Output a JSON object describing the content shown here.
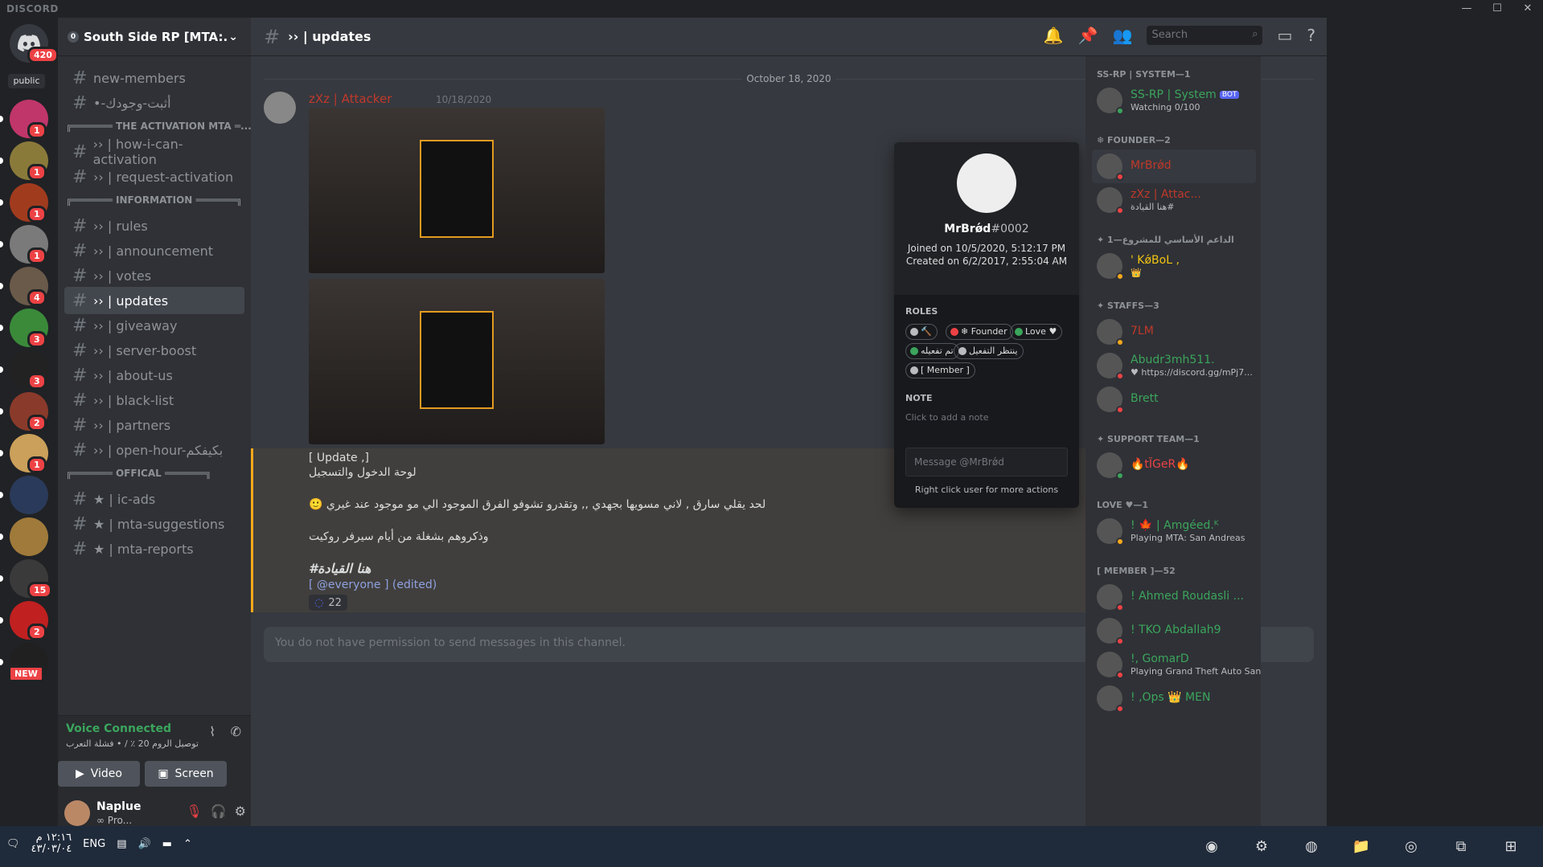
{
  "window": {
    "brand": "DISCORD",
    "controls": [
      "—",
      "☐",
      "✕"
    ]
  },
  "server_rail": {
    "home_badge": "420",
    "public_label": "public",
    "servers": [
      {
        "badge": "1",
        "color": "#c0366a"
      },
      {
        "badge": "1",
        "color": "#8a7a3a"
      },
      {
        "badge": "1",
        "color": "#a13b1e"
      },
      {
        "badge": "1",
        "color": "#7a7a7a"
      },
      {
        "badge": "4",
        "color": "#6a5a4a"
      },
      {
        "badge": "3",
        "color": "#3a8a3a"
      },
      {
        "badge": "3",
        "color": "#222222"
      },
      {
        "badge": "2",
        "color": "#8a3a2a"
      },
      {
        "badge": "1",
        "color": "#caa05a"
      },
      {
        "badge": "",
        "color": "#2a3a5a"
      },
      {
        "badge": "",
        "color": "#a07a3a"
      },
      {
        "badge": "15",
        "color": "#3a3a3a"
      },
      {
        "badge": "2",
        "color": "#c02020"
      },
      {
        "badge": "NEW",
        "color": "#202020"
      }
    ]
  },
  "guild": {
    "name": "South Side RP [MTA:...",
    "boost_level": "0"
  },
  "channel_list": {
    "items": [
      {
        "kind": "channel",
        "label": "new-members"
      },
      {
        "kind": "channel",
        "label": "•-أثبت-وجودك"
      },
      {
        "kind": "category",
        "label": "╔═══════ THE ACTIVATION MTA ═..."
      },
      {
        "kind": "channel",
        "label": "›› | how-i-can-activation"
      },
      {
        "kind": "channel",
        "label": "›› | request-activation"
      },
      {
        "kind": "category",
        "label": "╔═══════ INFORMATION ═══════╗"
      },
      {
        "kind": "channel",
        "label": "›› | rules"
      },
      {
        "kind": "channel",
        "label": "›› | announcement"
      },
      {
        "kind": "channel",
        "label": "›› | votes"
      },
      {
        "kind": "channel",
        "label": "›› | updates",
        "active": true
      },
      {
        "kind": "channel",
        "label": "›› | giveaway"
      },
      {
        "kind": "channel",
        "label": "›› | server-boost"
      },
      {
        "kind": "channel",
        "label": "›› | about-us"
      },
      {
        "kind": "channel",
        "label": "›› | black-list"
      },
      {
        "kind": "channel",
        "label": "›› | partners"
      },
      {
        "kind": "channel",
        "label": "›› | open-hour-بكيفكم"
      },
      {
        "kind": "category",
        "label": "╔═══════ OFFICAL ═══════╗"
      },
      {
        "kind": "channel",
        "label": "★ | ic-ads"
      },
      {
        "kind": "channel",
        "label": "★ | mta-suggestions"
      },
      {
        "kind": "channel",
        "label": "★ | mta-reports"
      }
    ]
  },
  "voice": {
    "title": "Voice Connected",
    "subtitle": "توصيل الروم 20 ٪ / • فشلة التعرب",
    "video_label": "Video",
    "screen_label": "Screen"
  },
  "user": {
    "name": "Naplue",
    "tag": "∞ Pro..."
  },
  "header": {
    "channel_title": "›› | updates",
    "search_placeholder": "Search"
  },
  "messages": {
    "date_divider": "October 18, 2020",
    "author": "zXz | Attacker",
    "timestamp": "10/18/2020",
    "lines": [
      "[ Update ,]",
      "لوحة الدخول والتسجيل",
      "🙂 لحد يقلي سارق , لاني مسويها بجهدي ,, وتقدرو تشوفو الفرق الموجود الي مو موجود عند غيري",
      "وذكروهم بشغلة من أيام سيرفر روكيت",
      "#هنا القيادة",
      "[ @everyone ] (edited)"
    ],
    "reaction_count": "22",
    "input_placeholder": "You do not have permission to send messages in this channel."
  },
  "popout": {
    "username": "MrBrǿd",
    "discriminator": "#0002",
    "joined": "Joined on 10/5/2020, 5:12:17 PM",
    "created": "Created on 6/2/2017, 2:55:04 AM",
    "roles_label": "ROLES",
    "roles": [
      {
        "label": "🔨",
        "color": "#b9bbbe"
      },
      {
        "label": "❄ Founder",
        "color": "#ed4245"
      },
      {
        "label": "Love ♥",
        "color": "#3ba55c"
      },
      {
        "label": "تم تفعيله",
        "color": "#3ba55c"
      },
      {
        "label": "ينتظر التفعيل",
        "color": "#b9bbbe"
      },
      {
        "label": "[ Member ]",
        "color": "#b9bbbe"
      }
    ],
    "note_label": "NOTE",
    "note_placeholder": "Click to add a note",
    "message_placeholder": "Message @MrBrǿd",
    "hint": "Right click user for more actions"
  },
  "members": {
    "groups": [
      {
        "title": "SS-RP | SYSTEM—1",
        "members": [
          {
            "name": "SS-RP | System",
            "bot": "BOT",
            "sub": "Watching 0/100",
            "color": "#3ba55c",
            "status": "#3ba55c"
          }
        ]
      },
      {
        "title": "❄ FOUNDER—2",
        "members": [
          {
            "name": "MrBrǿd",
            "sub": "",
            "color": "#c0392b",
            "status": "#ed4245",
            "highlight": true
          },
          {
            "name": "zXz | Attac...",
            "sub": "هنا القيادة#",
            "color": "#c0392b",
            "status": "#ed4245"
          }
        ]
      },
      {
        "title": "✦ الداعم الأساسي للمشروع—1",
        "members": [
          {
            "name": "' KǿBoL ,",
            "sub": "👑",
            "color": "#f1c40f",
            "status": "#faa81a"
          }
        ]
      },
      {
        "title": "✦ STAFFS—3",
        "members": [
          {
            "name": "7LM",
            "sub": "",
            "color": "#c0392b",
            "status": "#faa81a"
          },
          {
            "name": "Abudr3mh511.",
            "sub": "♥ https://discord.gg/mPj7...",
            "color": "#3ba55c",
            "status": "#ed4245"
          },
          {
            "name": "Brett",
            "sub": "",
            "color": "#3ba55c",
            "status": "#ed4245"
          }
        ]
      },
      {
        "title": "✦ SUPPORT TEAM—1",
        "members": [
          {
            "name": "🔥tÏGeR🔥",
            "sub": "",
            "color": "#ed4245",
            "status": "#3ba55c"
          }
        ]
      },
      {
        "title": "LOVE ♥—1",
        "members": [
          {
            "name": "! 🍁 | Amgéed.ᴷ",
            "sub": "Playing MTA: San Andreas",
            "color": "#3ba55c",
            "status": "#faa81a"
          }
        ]
      },
      {
        "title": "[ MEMBER ]—52",
        "members": [
          {
            "name": "! Ahmed Roudasli ...",
            "sub": "",
            "color": "#3ba55c",
            "status": "#ed4245"
          },
          {
            "name": "! TKO Abdallah9",
            "sub": "",
            "color": "#3ba55c",
            "status": "#ed4245"
          },
          {
            "name": "!, GomarD",
            "sub": "Playing Grand Theft Auto San...",
            "color": "#3ba55c",
            "status": "#ed4245"
          },
          {
            "name": "! ,Ops 👑 MEN",
            "sub": "",
            "color": "#3ba55c",
            "status": "#ed4245"
          }
        ]
      }
    ]
  },
  "taskbar": {
    "time": "١٢:١٦ م",
    "date": "٤٣/٠٣/٠٤",
    "lang": "ENG"
  }
}
